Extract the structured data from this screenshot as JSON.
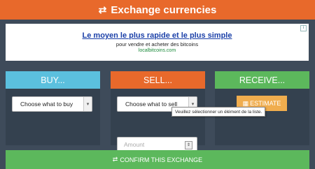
{
  "header": {
    "title": "Exchange currencies",
    "icon": "exchange-arrows-icon"
  },
  "ad": {
    "title": "Le moyen le plus rapide et le plus simple",
    "line": "pour vendre et acheter des bitcoins",
    "url": "localbitcoins.com",
    "corner": "i"
  },
  "buy": {
    "heading": "BUY...",
    "select": "Choose what to buy"
  },
  "sell": {
    "heading": "SELL...",
    "select": "Choose what to sell",
    "amount_placeholder": "Amount",
    "tooltip": "Veuillez sélectionner un élément de la liste."
  },
  "receive": {
    "heading": "RECEIVE...",
    "estimate": "ESTIMATE"
  },
  "confirm": {
    "label": "CONFIRM THIS EXCHANGE"
  },
  "colors": {
    "background": "#3e4b5a",
    "orange": "#e8692b",
    "blue": "#5bc0de",
    "green": "#5cb85c",
    "amber": "#f0ad4e"
  }
}
